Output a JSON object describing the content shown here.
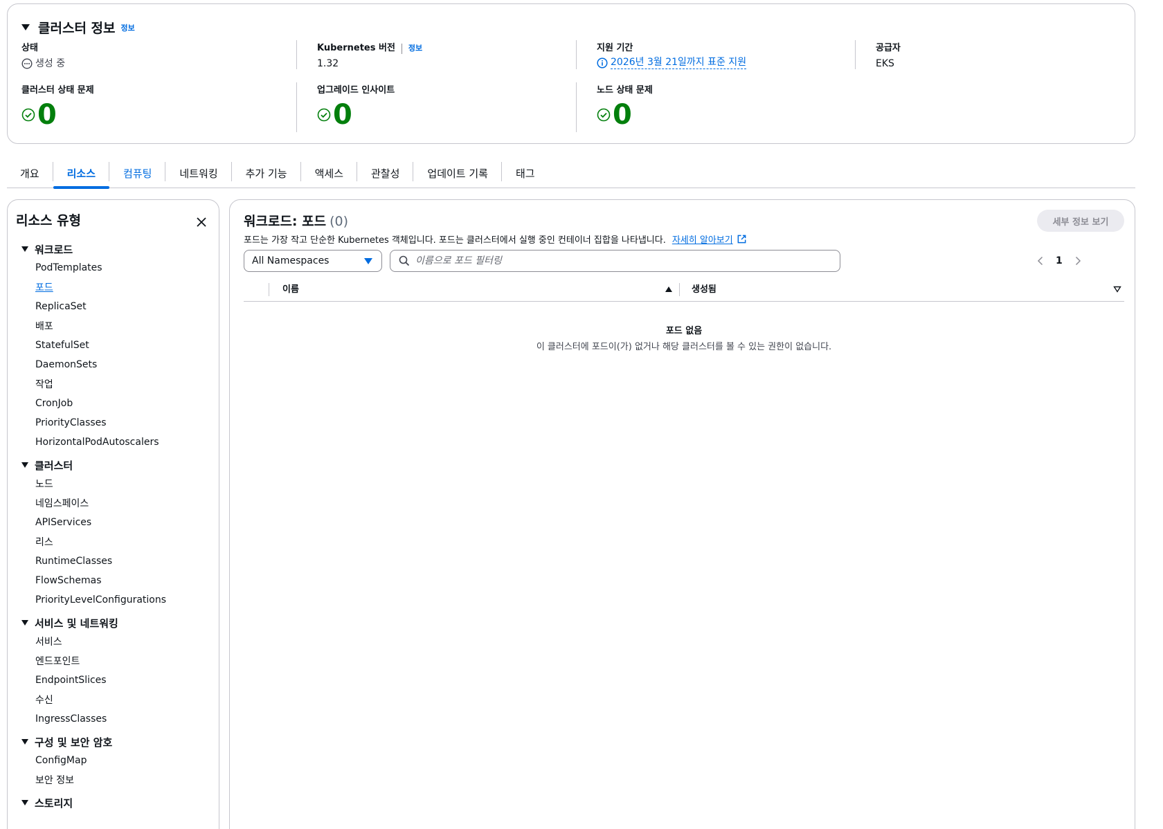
{
  "cluster_info": {
    "title": "클러스터 정보",
    "info_link": "정보",
    "status": {
      "label": "상태",
      "value": "생성 중"
    },
    "k8s_version": {
      "label": "Kubernetes 버전",
      "info_link": "정보",
      "value": "1.32"
    },
    "support_period": {
      "label": "지원 기간",
      "value": "2026년 3월 21일까지 표준 지원"
    },
    "provider": {
      "label": "공급자",
      "value": "EKS"
    },
    "cluster_health": {
      "label": "클러스터 상태 문제",
      "value": "0"
    },
    "upgrade_insights": {
      "label": "업그레이드 인사이트",
      "value": "0"
    },
    "node_health": {
      "label": "노드 상태 문제",
      "value": "0"
    }
  },
  "tabs": [
    "개요",
    "리소스",
    "컴퓨팅",
    "네트워킹",
    "추가 기능",
    "액세스",
    "관찰성",
    "업데이트 기록",
    "태그"
  ],
  "active_tab": "리소스",
  "sidebar": {
    "title": "리소스 유형",
    "groups": [
      {
        "label": "워크로드",
        "items": [
          "PodTemplates",
          "포드",
          "ReplicaSet",
          "배포",
          "StatefulSet",
          "DaemonSets",
          "작업",
          "CronJob",
          "PriorityClasses",
          "HorizontalPodAutoscalers"
        ]
      },
      {
        "label": "클러스터",
        "items": [
          "노드",
          "네임스페이스",
          "APIServices",
          "리스",
          "RuntimeClasses",
          "FlowSchemas",
          "PriorityLevelConfigurations"
        ]
      },
      {
        "label": "서비스 및 네트워킹",
        "items": [
          "서비스",
          "엔드포인트",
          "EndpointSlices",
          "수신",
          "IngressClasses"
        ]
      },
      {
        "label": "구성 및 보안 암호",
        "items": [
          "ConfigMap",
          "보안 정보"
        ]
      },
      {
        "label": "스토리지",
        "items": []
      }
    ]
  },
  "main": {
    "title": "워크로드: 포드",
    "count": "(0)",
    "detail_button": "세부 정보 보기",
    "description": "포드는 가장 작고 단순한 Kubernetes 객체입니다. 포드는 클러스터에서 실행 중인 컨테이너 집합을 나타냅니다.",
    "learn_more": "자세히 알아보기",
    "namespace_select": "All Namespaces",
    "search_placeholder": "이름으로 포드 필터링",
    "page": "1",
    "columns": [
      "이름",
      "생성됨"
    ],
    "empty_title": "포드 없음",
    "empty_text": "이 클러스터에 포드이(가) 없거나 해당 클러스터를 볼 수 있는 권한이 없습니다."
  },
  "colors": {
    "accent": "#006ce0",
    "success": "#037f0c",
    "border": "#c6c6cd",
    "text": "#0f141a"
  }
}
